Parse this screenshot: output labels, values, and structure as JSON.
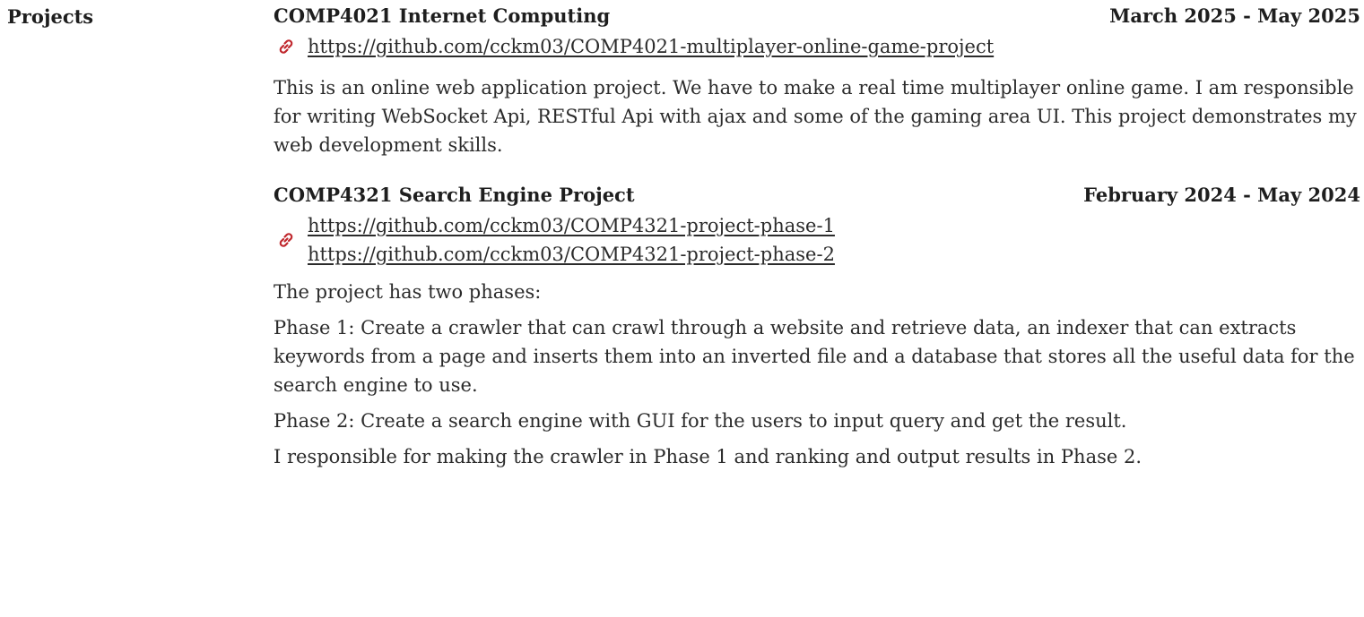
{
  "section": {
    "label": "Projects"
  },
  "projects": [
    {
      "title": "COMP4021 Internet Computing",
      "date": "March 2025 - May 2025",
      "links": [
        "https://github.com/cckm03/COMP4021-multiplayer-online-game-project"
      ],
      "paragraphs": [
        "This is an online web application project. We have to make a real time multiplayer online game. I am responsible for writing WebSocket Api, RESTful Api with ajax and some of the gaming area UI. This project demonstrates my web development skills."
      ]
    },
    {
      "title": "COMP4321 Search Engine Project",
      "date": "February 2024 - May 2024",
      "links": [
        "https://github.com/cckm03/COMP4321-project-phase-1",
        "https://github.com/cckm03/COMP4321-project-phase-2"
      ],
      "paragraphs": [
        "The project has two phases:",
        "Phase 1: Create a crawler that can crawl through a website and retrieve data, an indexer that can extracts keywords from a page and inserts them into an inverted file and a database that stores all the useful data for the search engine to use.",
        "Phase 2: Create a search engine with GUI for the users to input query and get the result.",
        "I responsible for making the crawler in Phase 1 and ranking and output results in Phase 2."
      ]
    }
  ],
  "colors": {
    "link_icon": "#c0272d",
    "text": "#2b2b2b"
  },
  "icons": {
    "link": "link-icon"
  }
}
